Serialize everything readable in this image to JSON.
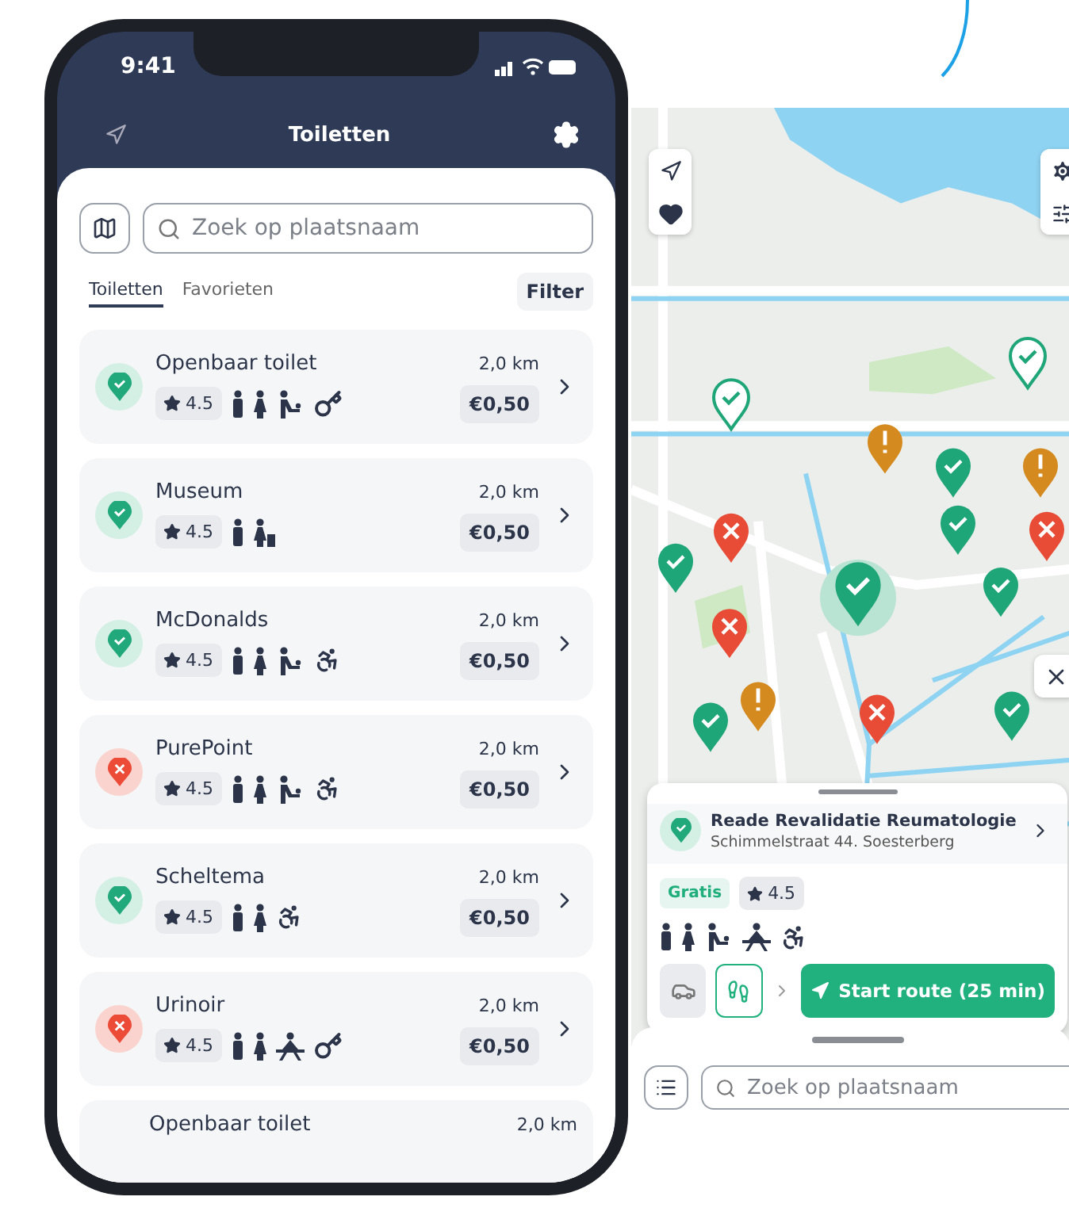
{
  "status_bar": {
    "time": "9:41"
  },
  "header": {
    "title": "Toiletten"
  },
  "search": {
    "placeholder": "Zoek op plaatsnaam"
  },
  "tabs": [
    {
      "label": "Toiletten",
      "selected": true
    },
    {
      "label": "Favorieten",
      "selected": false
    }
  ],
  "filter_button": "Filter",
  "toilets": [
    {
      "name": "Openbaar toilet",
      "open": true,
      "rating": "4.5",
      "distance": "2,0 km",
      "price": "€0,50",
      "amenities": [
        {
          "kind": "man"
        },
        {
          "kind": "woman"
        },
        {
          "kind": "baby"
        },
        {
          "kind": "key"
        }
      ]
    },
    {
      "name": "Museum",
      "open": true,
      "rating": "4.5",
      "distance": "2,0 km",
      "price": "€0,50",
      "amenities": [
        {
          "kind": "man"
        },
        {
          "kind": "woman-bin"
        }
      ]
    },
    {
      "name": "McDonalds",
      "open": true,
      "rating": "4.5",
      "distance": "2,0 km",
      "price": "€0,50",
      "amenities": [
        {
          "kind": "man"
        },
        {
          "kind": "woman"
        },
        {
          "kind": "baby"
        },
        {
          "kind": "wheelchair"
        }
      ]
    },
    {
      "name": "PurePoint",
      "open": false,
      "rating": "4.5",
      "distance": "2,0 km",
      "price": "€0,50",
      "amenities": [
        {
          "kind": "man"
        },
        {
          "kind": "woman"
        },
        {
          "kind": "baby"
        },
        {
          "kind": "wheelchair"
        }
      ]
    },
    {
      "name": "Scheltema",
      "open": true,
      "rating": "4.5",
      "distance": "2,0 km",
      "price": "€0,50",
      "amenities": [
        {
          "kind": "man"
        },
        {
          "kind": "woman"
        },
        {
          "kind": "wheelchair"
        }
      ]
    },
    {
      "name": "Urinoir",
      "open": false,
      "rating": "4.5",
      "distance": "2,0 km",
      "price": "€0,50",
      "amenities": [
        {
          "kind": "man"
        },
        {
          "kind": "woman"
        },
        {
          "kind": "table"
        },
        {
          "kind": "key"
        }
      ]
    },
    {
      "name": "Openbaar toilet",
      "distance": "2,0 km"
    }
  ],
  "detail": {
    "name": "Reade Revalidatie Reumatologie",
    "open": true,
    "address": "Schimmelstraat 44. Soesterberg",
    "price": "Gratis",
    "rating": "4.5",
    "amenities": [
      {
        "kind": "man"
      },
      {
        "kind": "woman"
      },
      {
        "kind": "baby"
      },
      {
        "kind": "table"
      },
      {
        "kind": "wheelchair"
      }
    ],
    "transport": [
      {
        "kind": "car",
        "selected": false
      },
      {
        "kind": "walk",
        "selected": true
      }
    ],
    "route_button": "Start route (25 min)"
  },
  "map_search": {
    "placeholder": "Zoek op plaatsnaam"
  }
}
